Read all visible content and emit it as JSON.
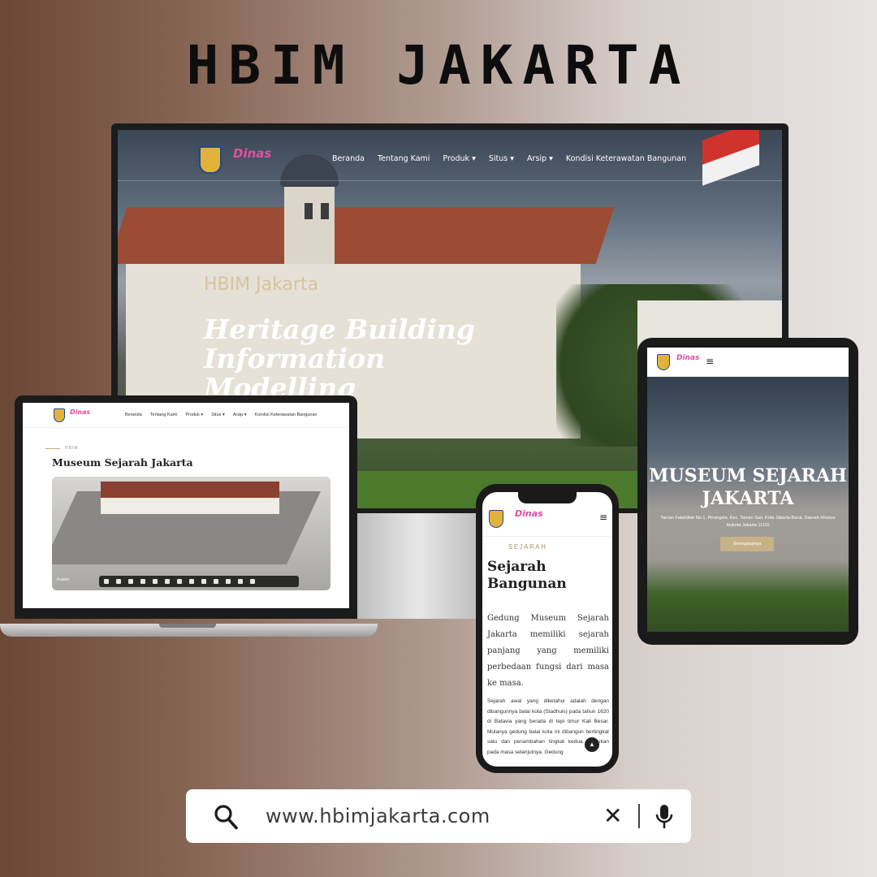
{
  "headline": "HBIM JAKARTA",
  "logos": {
    "dinas_text": "Dinas",
    "dinas_sub": "Kebudayaan"
  },
  "monitor": {
    "nav": [
      "Beranda",
      "Tentang Kami",
      "Produk",
      "Situs",
      "Arsip",
      "Kondisi Keterawatan Bangunan"
    ],
    "kicker": "HBIM Jakarta",
    "hero_line1": "Heritage Building Information",
    "hero_line2": "Modelling"
  },
  "laptop": {
    "nav": [
      "Beranda",
      "Tentang Kami",
      "Produk",
      "Situs",
      "Arsip",
      "Kondisi Keterawatan Bangunan"
    ],
    "kicker": "HBIM",
    "title": "Museum Sejarah Jakarta",
    "viewer_label": "Fusion"
  },
  "tablet": {
    "title_line1": "MUSEUM SEJARAH",
    "title_line2": "JAKARTA",
    "address": "Taman Fatahillah No.1, Pinangsia, Kec. Taman Sari, Kota Jakarta Barat, Daerah Khusus Ibukota Jakarta 11110",
    "button": "Selengkapnya"
  },
  "phone": {
    "kicker": "SEJARAH",
    "title": "Sejarah Bangunan",
    "lead": "Gedung Museum Sejarah Jakarta memiliki sejarah panjang yang memiliki perbedaan fungsi dari masa ke masa.",
    "body": "Sejarah awal yang diketahui adalah dengan dibangunnya balai kota (Stadhuis) pada tahun 1620 di Batavia yang berada di tepi timur Kali Besar. Mulanya gedung balai kota ini dibangun bertingkat satu dan penambahan tingkat kedua dilakukan pada masa selanjutnya. Gedung"
  },
  "search": {
    "url": "www.hbimjakarta.com"
  },
  "icons": {
    "search": "search-icon",
    "clear": "close-icon",
    "mic": "microphone-icon",
    "menu": "hamburger-menu-icon",
    "dropdown": "chevron-down-icon",
    "scroll_top": "chevron-up-icon"
  }
}
